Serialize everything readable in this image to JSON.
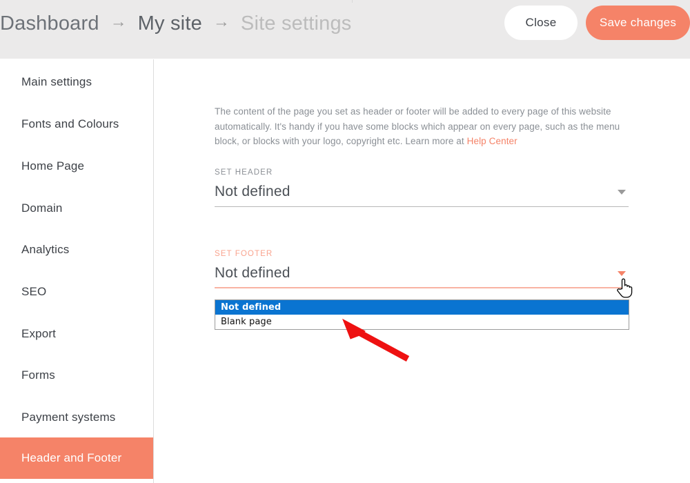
{
  "topbar": {
    "breadcrumb": [
      {
        "label": "Dashboard",
        "state": "dark"
      },
      {
        "label": "My site",
        "state": "mid"
      },
      {
        "label": "Site settings",
        "state": "faded"
      }
    ],
    "separator": "→",
    "close_label": "Close",
    "save_label": "Save changes",
    "background_color": "#ebeaea",
    "accent_color": "#f58368"
  },
  "sidebar": {
    "items": [
      {
        "label": "Main settings",
        "active": false
      },
      {
        "label": "Fonts and Colours",
        "active": false
      },
      {
        "label": "Home Page",
        "active": false
      },
      {
        "label": "Domain",
        "active": false
      },
      {
        "label": "Analytics",
        "active": false
      },
      {
        "label": "SEO",
        "active": false
      },
      {
        "label": "Export",
        "active": false
      },
      {
        "label": "Forms",
        "active": false
      },
      {
        "label": "Payment systems",
        "active": false
      },
      {
        "label": "Header and Footer",
        "active": true
      }
    ],
    "active_color": "#f58368"
  },
  "main": {
    "intro_text_1": "The content of the page you set as header or footer will be added to every page of this website automatically. It's handy if you have some blocks which appear on every page, such as the menu block, or blocks with your logo, copyright etc. Learn more at ",
    "help_link_label": "Help Center",
    "header_field": {
      "label": "SET HEADER",
      "value": "Not defined",
      "caret_icon": "chevron-down-icon"
    },
    "footer_field": {
      "label": "SET FOOTER",
      "value": "Not defined",
      "caret_icon": "chevron-down-icon",
      "expanded": true,
      "options": [
        {
          "label": "Not defined",
          "selected": true
        },
        {
          "label": "Blank page",
          "selected": false
        }
      ]
    }
  },
  "overlay": {
    "cursor_icon": "pointer-hand-cursor",
    "annotation_icon": "red-arrow-annotation",
    "annotation_color": "#ee1111"
  }
}
